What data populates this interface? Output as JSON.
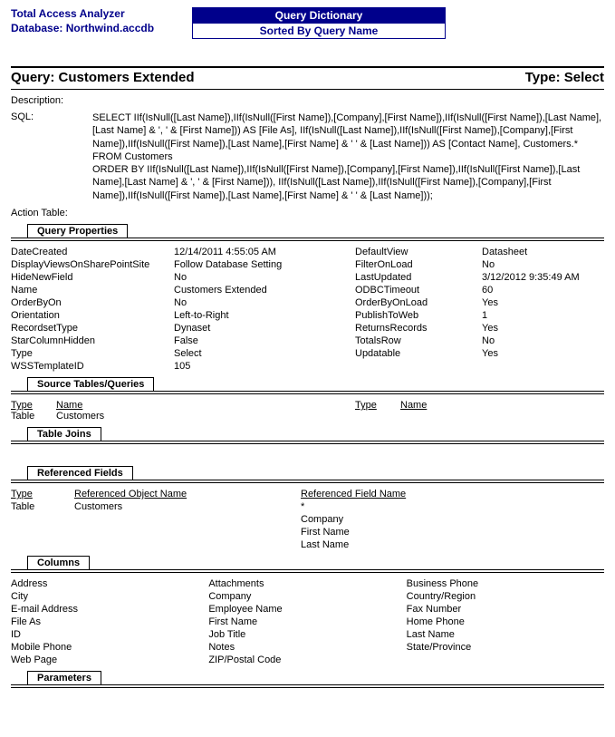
{
  "header": {
    "app_name": "Total Access Analyzer",
    "database_label": "Database: Northwind.accdb",
    "banner_title": "Query Dictionary",
    "banner_sub": "Sorted By Query Name"
  },
  "title": {
    "query_label": "Query: Customers Extended",
    "type_label": "Type: Select"
  },
  "meta": {
    "description_label": "Description:",
    "sql_label": "SQL:",
    "sql_text": "SELECT IIf(IsNull([Last Name]),IIf(IsNull([First Name]),[Company],[First Name]),IIf(IsNull([First Name]),[Last Name],[Last Name] & ', ' & [First Name])) AS [File As], IIf(IsNull([Last Name]),IIf(IsNull([First Name]),[Company],[First Name]),IIf(IsNull([First Name]),[Last Name],[First Name] & ' ' & [Last Name])) AS [Contact Name], Customers.*\nFROM Customers\nORDER BY IIf(IsNull([Last Name]),IIf(IsNull([First Name]),[Company],[First Name]),IIf(IsNull([First Name]),[Last Name],[Last Name] & ', ' & [First Name])), IIf(IsNull([Last Name]),IIf(IsNull([First Name]),[Company],[First Name]),IIf(IsNull([First Name]),[Last Name],[First Name] & ' ' & [Last Name]));",
    "action_table_label": "Action Table:"
  },
  "sections": {
    "query_properties": "Query Properties",
    "source": "Source Tables/Queries",
    "table_joins": "Table Joins",
    "referenced_fields": "Referenced Fields",
    "columns": "Columns",
    "parameters": "Parameters"
  },
  "properties": [
    {
      "l": "DateCreated",
      "v": "12/14/2011 4:55:05 AM",
      "l2": "DefaultView",
      "v2": "Datasheet"
    },
    {
      "l": "DisplayViewsOnSharePointSite",
      "v": "Follow Database Setting",
      "l2": "FilterOnLoad",
      "v2": "No"
    },
    {
      "l": "HideNewField",
      "v": "No",
      "l2": "LastUpdated",
      "v2": "3/12/2012 9:35:49 AM"
    },
    {
      "l": "Name",
      "v": "Customers Extended",
      "l2": "ODBCTimeout",
      "v2": "60"
    },
    {
      "l": "OrderByOn",
      "v": "No",
      "l2": "OrderByOnLoad",
      "v2": "Yes"
    },
    {
      "l": "Orientation",
      "v": "Left-to-Right",
      "l2": "PublishToWeb",
      "v2": "1"
    },
    {
      "l": "RecordsetType",
      "v": "Dynaset",
      "l2": "ReturnsRecords",
      "v2": "Yes"
    },
    {
      "l": "StarColumnHidden",
      "v": "False",
      "l2": "TotalsRow",
      "v2": "No"
    },
    {
      "l": "Type",
      "v": "Select",
      "l2": "Updatable",
      "v2": "Yes"
    },
    {
      "l": "WSSTemplateID",
      "v": "105",
      "l2": "",
      "v2": ""
    }
  ],
  "source_headers": {
    "type": "Type",
    "name": "Name"
  },
  "source_rows": [
    {
      "type": "Table",
      "name": "Customers"
    }
  ],
  "ref_headers": {
    "type": "Type",
    "obj": "Referenced Object Name",
    "field": "Referenced Field Name"
  },
  "ref_rows": [
    {
      "type": "Table",
      "obj": "Customers",
      "field": "*"
    },
    {
      "type": "",
      "obj": "",
      "field": "Company"
    },
    {
      "type": "",
      "obj": "",
      "field": "First Name"
    },
    {
      "type": "",
      "obj": "",
      "field": "Last Name"
    }
  ],
  "columns": [
    {
      "a": "Address",
      "b": "Attachments",
      "c": "Business Phone"
    },
    {
      "a": "City",
      "b": "Company",
      "c": "Country/Region"
    },
    {
      "a": "E-mail Address",
      "b": "Employee Name",
      "c": "Fax Number"
    },
    {
      "a": "File As",
      "b": "First Name",
      "c": "Home Phone"
    },
    {
      "a": "ID",
      "b": "Job Title",
      "c": "Last Name"
    },
    {
      "a": "Mobile Phone",
      "b": "Notes",
      "c": "State/Province"
    },
    {
      "a": "Web Page",
      "b": "ZIP/Postal Code",
      "c": ""
    }
  ]
}
